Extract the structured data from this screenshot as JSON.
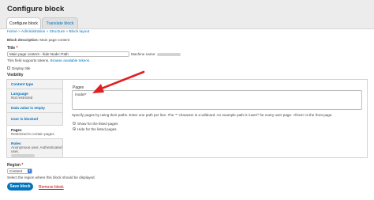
{
  "header": {
    "title": "Configure block",
    "tabs": [
      {
        "label": "Configure block",
        "active": true
      },
      {
        "label": "Translate block",
        "active": false
      }
    ]
  },
  "breadcrumb": [
    "Home",
    "Administration",
    "Structure",
    "Block layout"
  ],
  "breadcrumb_separator": "»",
  "block_description": {
    "label": "Block description:",
    "value": "Main page content"
  },
  "title_field": {
    "label": "Title",
    "required_mark": "*",
    "value": "Main page content - hide Node::Path",
    "machine_name_label": "Machine name:",
    "help_prefix": "This field supports tokens.",
    "help_link": "Browse available tokens."
  },
  "display_title": {
    "label": "Display title",
    "checked": false
  },
  "visibility": {
    "label": "Visibility",
    "tabs": [
      {
        "title": "Content type",
        "summary": ""
      },
      {
        "title": "Language",
        "summary": "Not restricted"
      },
      {
        "title": "Data value is empty",
        "summary": ""
      },
      {
        "title": "User is blocked",
        "summary": ""
      },
      {
        "title": "Pages",
        "summary": "Restricted to certain pages"
      },
      {
        "title": "Roles",
        "summary": "Anonymous user, Authenticated user,"
      }
    ],
    "active_tab_index": 4,
    "pages": {
      "label": "Pages",
      "value": "/node/*",
      "help": "Specify pages by using their paths. Enter one path per line. The '*' character is a wildcard. An example path is /user/* for every user page. <front> is the front page.",
      "options": [
        {
          "label": "Show for the listed pages",
          "checked": false
        },
        {
          "label": "Hide for the listed pages",
          "checked": true
        }
      ]
    }
  },
  "region": {
    "label": "Region",
    "required_mark": "*",
    "value": "Content",
    "help": "Select the region where this block should be displayed."
  },
  "actions": {
    "save": "Save block",
    "remove": "Remove block"
  },
  "colors": {
    "accent": "#0074bd",
    "arrow": "#e02020",
    "danger": "#cc0000"
  }
}
